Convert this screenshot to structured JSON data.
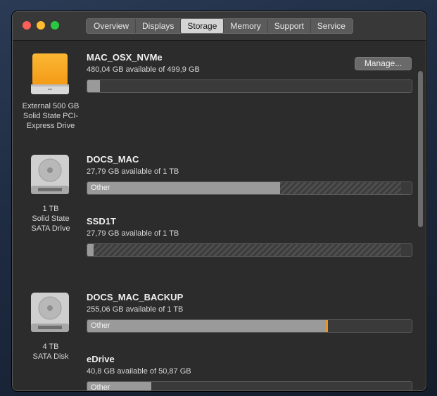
{
  "window": {
    "tabs": [
      {
        "label": "Overview",
        "selected": false
      },
      {
        "label": "Displays",
        "selected": false
      },
      {
        "label": "Storage",
        "selected": true
      },
      {
        "label": "Memory",
        "selected": false
      },
      {
        "label": "Support",
        "selected": false
      },
      {
        "label": "Service",
        "selected": false
      }
    ]
  },
  "colors": {
    "close": "#fe5f57",
    "minimize": "#febc2e",
    "zoom": "#28c840",
    "orange_segment": "#e8952e",
    "used_segment": "#9a9a9a"
  },
  "drives": [
    {
      "icon": "external-ssd-orange-icon",
      "caption": [
        "External 500 GB",
        "Solid State PCI-",
        "Express Drive"
      ],
      "volumes": [
        {
          "name": "MAC_OSX_NVMe",
          "available": "480,04 GB available of 499,9 GB",
          "used_fraction": 0.04,
          "segment_label": "",
          "manage_label": "Manage..."
        }
      ]
    },
    {
      "icon": "internal-hard-drive-icon",
      "caption": [
        "1 TB",
        "Solid State",
        "SATA Drive"
      ],
      "volumes": [
        {
          "name": "DOCS_MAC",
          "available": "27,79 GB available of 1 TB",
          "segment_label": "Other",
          "used_fraction": 0.595,
          "other_volumes_fraction": 0.372
        },
        {
          "name": "SSD1T",
          "available": "27,79 GB available of 1 TB",
          "segment_label": "",
          "used_fraction": 0.02,
          "other_volumes_fraction": 0.947
        }
      ]
    },
    {
      "icon": "internal-hard-drive-icon",
      "caption": [
        "4 TB",
        "SATA Disk"
      ],
      "volumes": [
        {
          "name": "DOCS_MAC_BACKUP",
          "available": "255,06 GB available of 1 TB",
          "segment_label": "Other",
          "used_fraction": 0.735,
          "orange_fraction": 0.006
        },
        {
          "name": "eDrive",
          "available": "40,8 GB available of 50,87 GB",
          "segment_label": "Other",
          "used_fraction": 0.198
        }
      ]
    }
  ]
}
